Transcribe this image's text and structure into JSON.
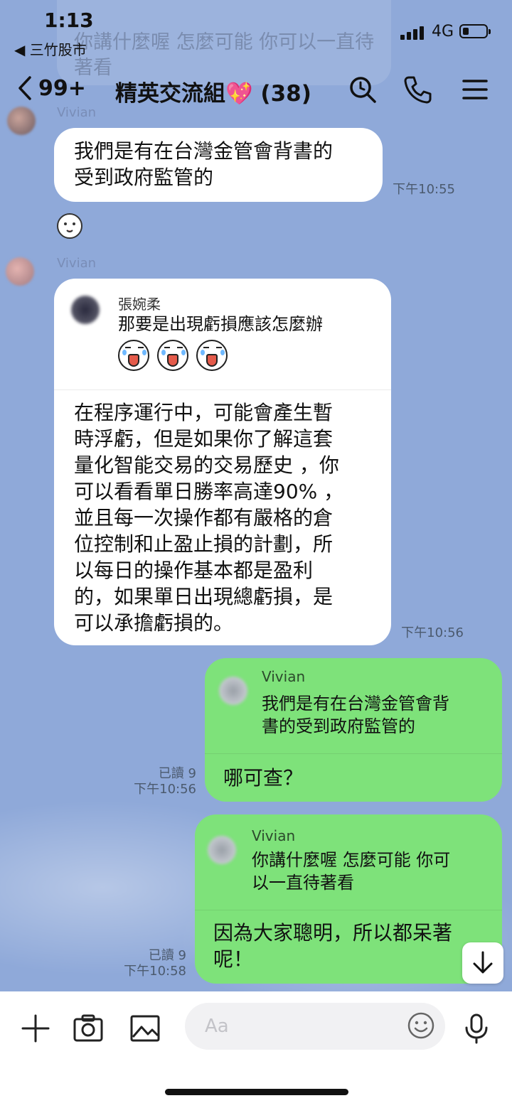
{
  "status_bar": {
    "time": "1:13",
    "back_app": "◀ 三竹股市",
    "network": "4G"
  },
  "background_preview": {
    "text": "你講什麼喔 怎麼可能 你可以一直待著看"
  },
  "header": {
    "unread_count": "99+",
    "title": "精英交流組",
    "title_emoji": "💖",
    "member_count": "(38)"
  },
  "messages": [
    {
      "sender": "Vivian",
      "text": "我們是有在台灣金管會背書的\n受到政府監管的",
      "time": "下午10:55"
    },
    {
      "sender": "Vivian",
      "reply_to": {
        "name": "張婉柔",
        "text": "那要是出現虧損應該怎麼辦"
      },
      "text": "在程序運行中，可能會產生暫\n時浮虧，但是如果你了解這套\n量化智能交易的交易歷史 ，你\n可以看看單日勝率高達90% ，\n並且每一次操作都有嚴格的倉\n位控制和止盈止損的計劃，所\n以每日的操作基本都是盈利\n的，如果單日出現總虧損，是\n可以承擔虧損的。",
      "time": "下午10:56"
    },
    {
      "mine": true,
      "reply_to": {
        "name": "Vivian",
        "text": "我們是有在台灣金管會背\n書的受到政府監管的"
      },
      "text": "哪可查？",
      "read": "已讀 9",
      "time": "下午10:56"
    },
    {
      "mine": true,
      "reply_to": {
        "name": "Vivian",
        "text": "你講什麼喔 怎麼可能 你可\n以一直待著看"
      },
      "text": "因為大家聰明，所以都呆著\n呢！",
      "read": "已讀 9",
      "time": "下午10:58"
    }
  ],
  "input_bar": {
    "placeholder": "Aa"
  },
  "icons": [
    "plus-icon",
    "camera-icon",
    "image-icon",
    "emoji-icon",
    "mic-icon",
    "search-icon",
    "phone-icon",
    "menu-icon",
    "back-chevron-icon",
    "scroll-down-icon"
  ]
}
